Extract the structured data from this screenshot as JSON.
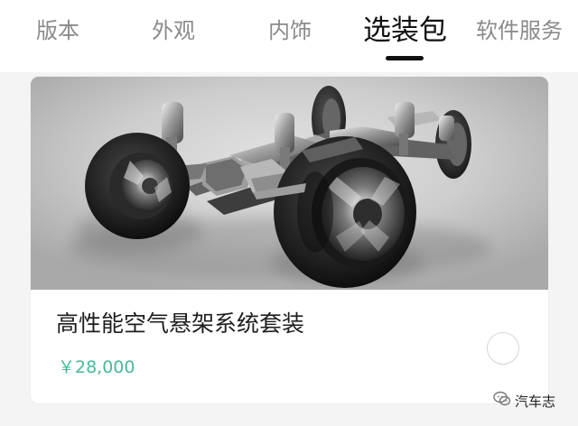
{
  "tabs": [
    {
      "label": "版本",
      "active": false
    },
    {
      "label": "外观",
      "active": false
    },
    {
      "label": "内饰",
      "active": false
    },
    {
      "label": "选装包",
      "active": true
    },
    {
      "label": "软件服务",
      "active": false
    }
  ],
  "card": {
    "image_icon": "air-suspension-chassis",
    "title": "高性能空气悬架系统套装",
    "price": "￥28,000",
    "selected": false
  },
  "watermark": {
    "icon": "wechat-icon",
    "text": "汽车志"
  },
  "colors": {
    "active_tab": "#111111",
    "inactive_tab": "#8a8a8a",
    "price": "#45b99a"
  }
}
